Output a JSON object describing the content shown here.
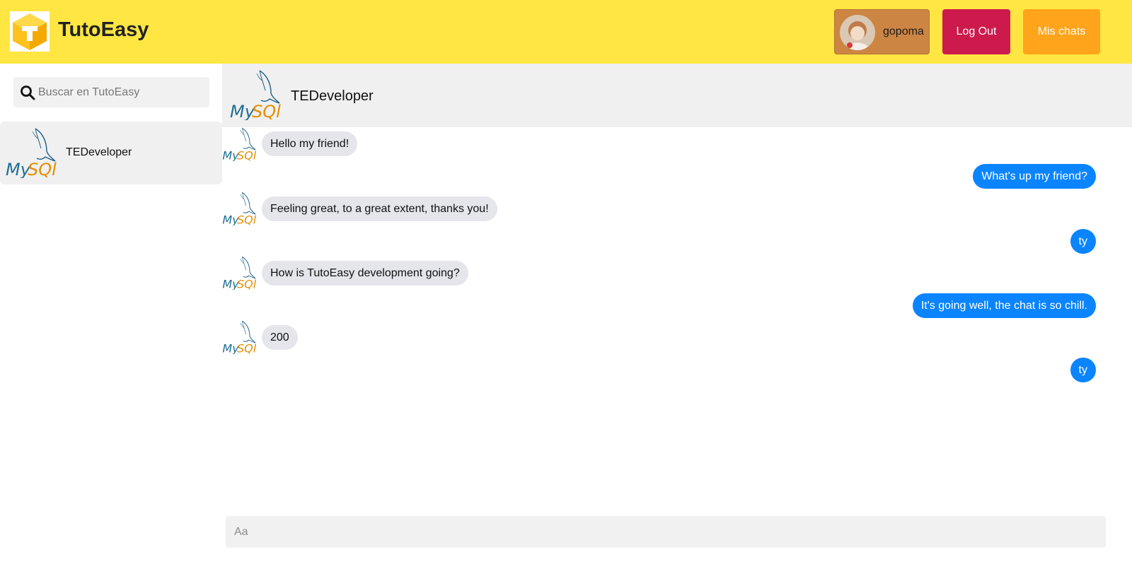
{
  "header": {
    "brand": "TutoEasy",
    "user_name": "gopoma",
    "logout_label": "Log Out",
    "my_chats_label": "Mis chats"
  },
  "sidebar": {
    "search_placeholder": "Buscar en TutoEasy",
    "contacts": [
      {
        "name": "TEDeveloper",
        "logo_text": "MySQL"
      }
    ]
  },
  "chat": {
    "contact_name": "TEDeveloper",
    "logo_text": "MySQL",
    "messages": [
      {
        "from": "them",
        "text": "Hello my friend!"
      },
      {
        "from": "me",
        "text": "What's up my friend?"
      },
      {
        "from": "them",
        "text": "Feeling great, to a great extent, thanks you!"
      },
      {
        "from": "me",
        "text": "ty"
      },
      {
        "from": "them",
        "text": "How is TutoEasy development going?"
      },
      {
        "from": "me",
        "text": "It's going well, the chat is so chill."
      },
      {
        "from": "them",
        "text": "200"
      },
      {
        "from": "me",
        "text": "ty"
      }
    ],
    "composer_placeholder": "Aa"
  },
  "colors": {
    "topbar": "#ffe642",
    "logout": "#cd1a4d",
    "my_chats": "#ffa41b",
    "user_button": "#cd8544",
    "outgoing_bubble": "#0a84ff",
    "incoming_bubble": "#e4e6eb"
  }
}
